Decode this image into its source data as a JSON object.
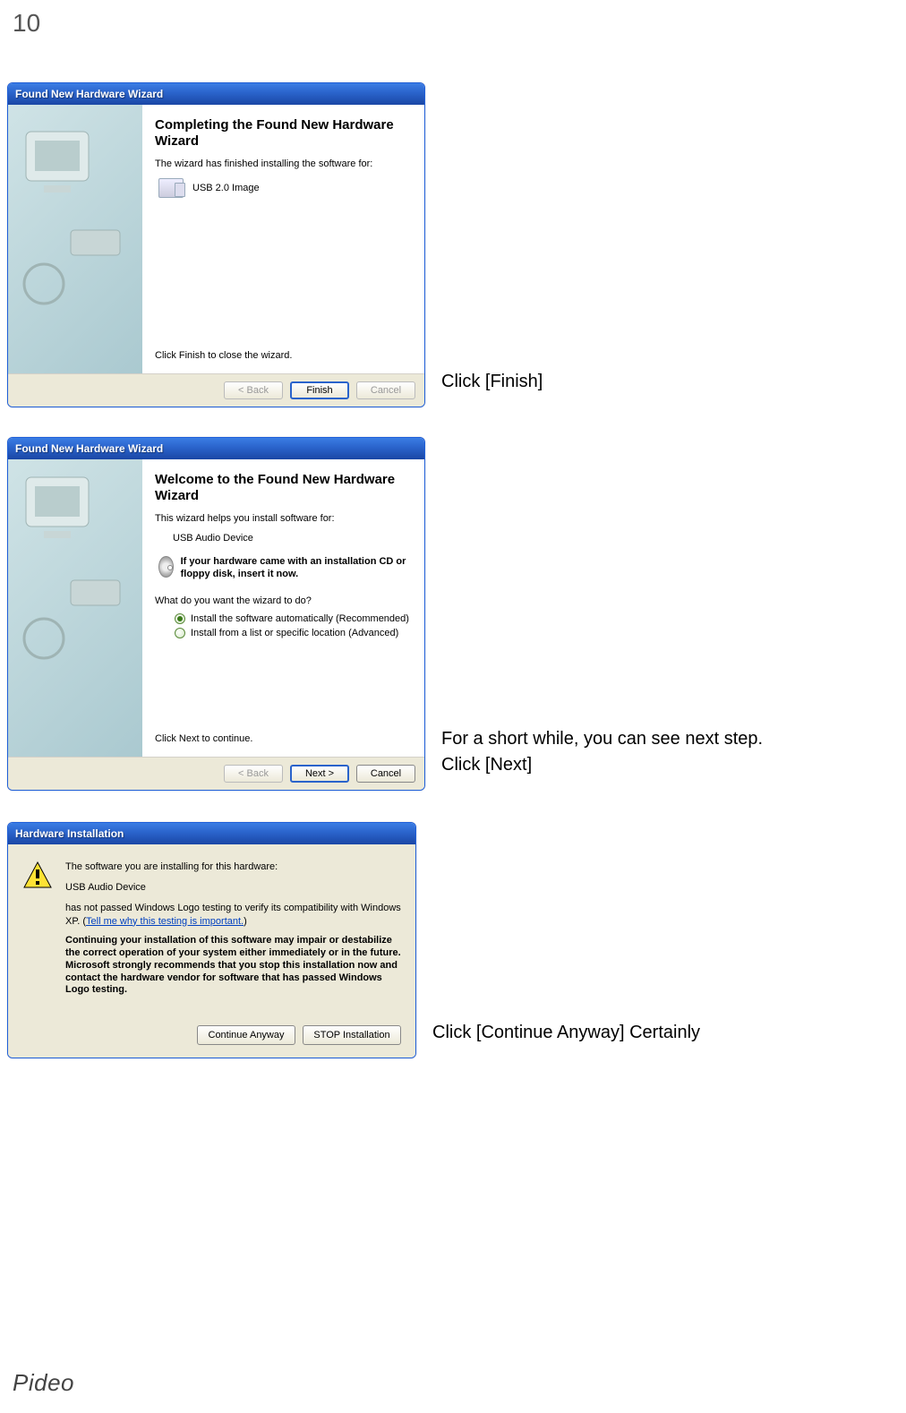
{
  "page_number": "10",
  "footer_brand": "Pideo",
  "dialog1": {
    "title": "Found New Hardware Wizard",
    "heading": "Completing the Found New Hardware Wizard",
    "line1": "The wizard has finished installing the software for:",
    "device": "USB 2.0 Image",
    "close_hint": "Click Finish to close the wizard.",
    "back": "< Back",
    "finish": "Finish",
    "cancel": "Cancel"
  },
  "instruction1": "Click [Finish]",
  "dialog2": {
    "title": "Found New Hardware Wizard",
    "heading": "Welcome to the Found New Hardware Wizard",
    "line1": "This wizard helps you install software for:",
    "device": "USB Audio Device",
    "cd_line": "If your hardware came with an installation CD or floppy disk, insert it now.",
    "prompt": "What do you want the wizard to do?",
    "option1": "Install the software automatically (Recommended)",
    "option2": "Install from a list or specific location (Advanced)",
    "continue_hint": "Click Next to continue.",
    "back": "< Back",
    "next": "Next >",
    "cancel": "Cancel"
  },
  "instruction2a": "For a short while, you can see next step.",
  "instruction2b": "Click [Next]",
  "dialog3": {
    "title": "Hardware Installation",
    "line1": "The software you are installing for this hardware:",
    "device": "USB Audio Device",
    "line2a": "has not passed Windows Logo testing to verify its compatibility with Windows XP. (",
    "link": "Tell me why this testing is important.",
    "line2b": ")",
    "bold": "Continuing your installation of this software may impair or destabilize the correct operation of your system either immediately or in the future. Microsoft strongly recommends that you stop this installation now and contact the hardware vendor for software that has passed Windows Logo testing.",
    "continue": "Continue Anyway",
    "stop": "STOP Installation"
  },
  "instruction3": "Click [Continue Anyway] Certainly"
}
